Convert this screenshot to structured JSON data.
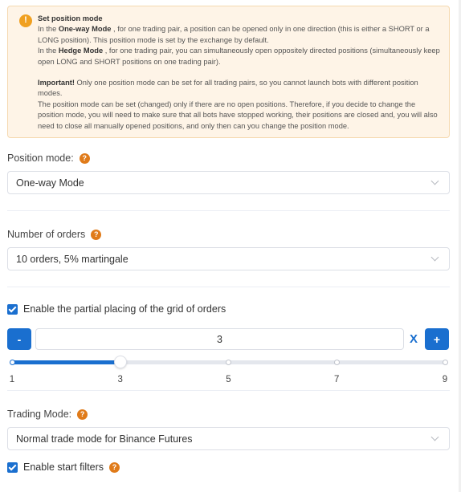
{
  "notice": {
    "icon": "exclamation-icon",
    "title": "Set position mode",
    "line1_pre": "In the ",
    "line1_bold": "One-way Mode",
    "line1_post": " , for one trading pair, a position can be opened only in one direction (this is either a SHORT or a LONG position). This position mode is set by the exchange by default.",
    "line2_pre": "In the ",
    "line2_bold": "Hedge Mode",
    "line2_post": " , for one trading pair, you can simultaneously open oppositely directed positions (simultaneously keep open LONG and SHORT positions on one trading pair).",
    "important_bold": "Important!",
    "important_text": " Only one position mode can be set for all trading pairs, so you cannot launch bots with different position modes.",
    "last": "The position mode can be set (changed) only if there are no open positions. Therefore, if you decide to change the position mode, you will need to make sure that all bots have stopped working, their positions are closed and, you will also need to close all manually opened positions, and only then can you change the position mode."
  },
  "position_mode": {
    "label": "Position mode:",
    "help_icon": "question-icon",
    "value": "One-way Mode"
  },
  "orders": {
    "label": "Number of orders",
    "help_icon": "question-icon",
    "value": "10 orders, 5% martingale"
  },
  "partial": {
    "checkbox_label": "Enable the partial placing of the grid of orders",
    "checked": true,
    "minus": "-",
    "plus": "+",
    "value": "3",
    "x_label": "X",
    "slider": {
      "min": 1,
      "max": 9,
      "value": 3,
      "ticks": [
        "1",
        "3",
        "5",
        "7",
        "9"
      ]
    }
  },
  "trading_mode": {
    "label": "Trading Mode:",
    "help_icon": "question-icon",
    "value": "Normal trade mode for Binance Futures"
  },
  "start_filters": {
    "label": "Enable start filters",
    "checked": true,
    "help_icon": "question-icon"
  },
  "colors": {
    "accent": "#1a6fcf",
    "warning": "#f0a020",
    "help": "#e07b1a"
  }
}
